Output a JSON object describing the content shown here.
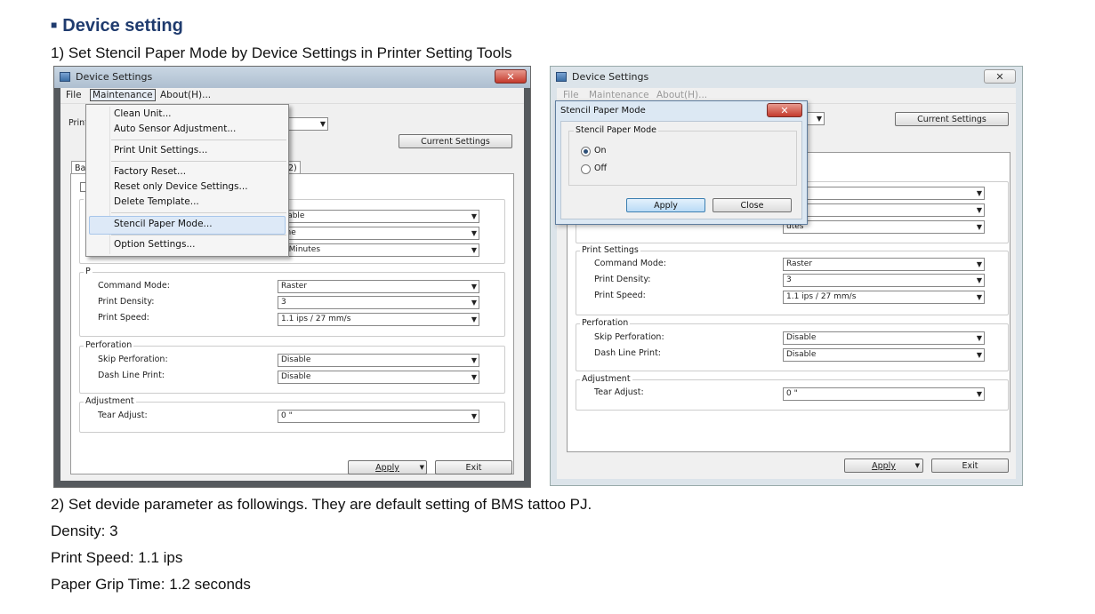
{
  "heading": {
    "bullet": "■",
    "title": "Device setting"
  },
  "step1": "1) Set Stencil Paper Mode by Device Settings in Printer Setting Tools",
  "step2": "2) Set devide parameter as followings. They are default setting of BMS tattoo PJ.",
  "params": [
    "Density: 3",
    "Print Speed: 1.1 ips",
    "Paper Grip Time: 1.2 seconds"
  ],
  "left_window": {
    "title": "Device Settings",
    "close": "✕",
    "menu": {
      "file": "File",
      "maintenance": "Maintenance",
      "about": "About(H)..."
    },
    "printer_label_partial": "Printe",
    "current_settings": "Current Settings",
    "tab_partial_left": "Bas",
    "tab_partial_right": "2)",
    "dropdown": {
      "items": [
        "Clean Unit...",
        "Auto Sensor Adjustment...",
        "Print Unit Settings...",
        "Factory Reset...",
        "Reset only Device Settings...",
        "Delete Template...",
        "Stencil Paper Mode...",
        "Option Settings..."
      ]
    },
    "upper_values_partial": [
      "isable",
      "one",
      "5 Minutes"
    ],
    "group_partial_letter": "P",
    "print_group_partial": "P",
    "apply": "Apply",
    "exit": "Exit"
  },
  "right_window": {
    "title": "Device Settings",
    "close": "✕",
    "menu_partial": {
      "file": "File",
      "maintenance": "Maintenance",
      "about": "About(H)..."
    },
    "current_settings": "Current Settings",
    "upper_values_partial": [
      "",
      "",
      "utes"
    ],
    "apply": "Apply",
    "exit": "Exit"
  },
  "print_settings": {
    "group": "Print Settings",
    "command_mode_label": "Command Mode:",
    "command_mode": "Raster",
    "print_density_label": "Print Density:",
    "print_density": "3",
    "print_speed_label": "Print Speed:",
    "print_speed": "1.1 ips / 27 mm/s"
  },
  "perforation": {
    "group": "Perforation",
    "skip_label": "Skip Perforation:",
    "skip": "Disable",
    "dash_label": "Dash Line Print:",
    "dash": "Disable"
  },
  "adjustment": {
    "group": "Adjustment",
    "tear_label": "Tear Adjust:",
    "tear": "0 \""
  },
  "stencil_dialog": {
    "title": "Stencil Paper Mode",
    "group": "Stencil Paper Mode",
    "on": "On",
    "off": "Off",
    "selected": "On",
    "apply": "Apply",
    "close": "Close",
    "close_x": "✕"
  }
}
